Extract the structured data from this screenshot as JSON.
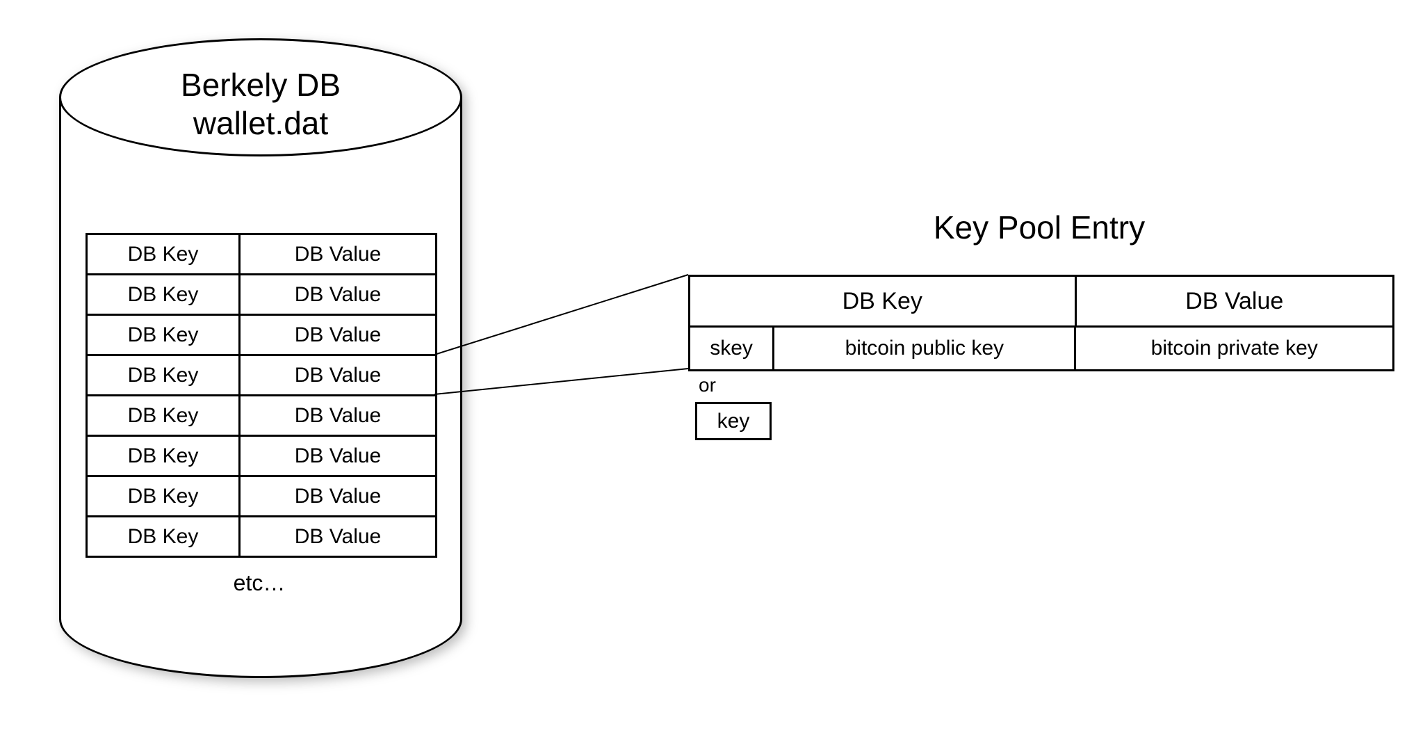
{
  "cylinder": {
    "title_line1": "Berkely DB",
    "title_line2": "wallet.dat",
    "rows": [
      {
        "key": "DB Key",
        "value": "DB Value"
      },
      {
        "key": "DB Key",
        "value": "DB Value"
      },
      {
        "key": "DB Key",
        "value": "DB Value"
      },
      {
        "key": "DB Key",
        "value": "DB Value"
      },
      {
        "key": "DB Key",
        "value": "DB Value"
      },
      {
        "key": "DB Key",
        "value": "DB Value"
      },
      {
        "key": "DB Key",
        "value": "DB Value"
      },
      {
        "key": "DB Key",
        "value": "DB Value"
      }
    ],
    "etc": "etc…"
  },
  "pool": {
    "title": "Key Pool Entry",
    "header_key": "DB Key",
    "header_value": "DB Value",
    "row": {
      "skey": "skey",
      "pubkey": "bitcoin public key",
      "privkey": "bitcoin private key"
    },
    "or_label": "or",
    "alt_key": "key"
  }
}
